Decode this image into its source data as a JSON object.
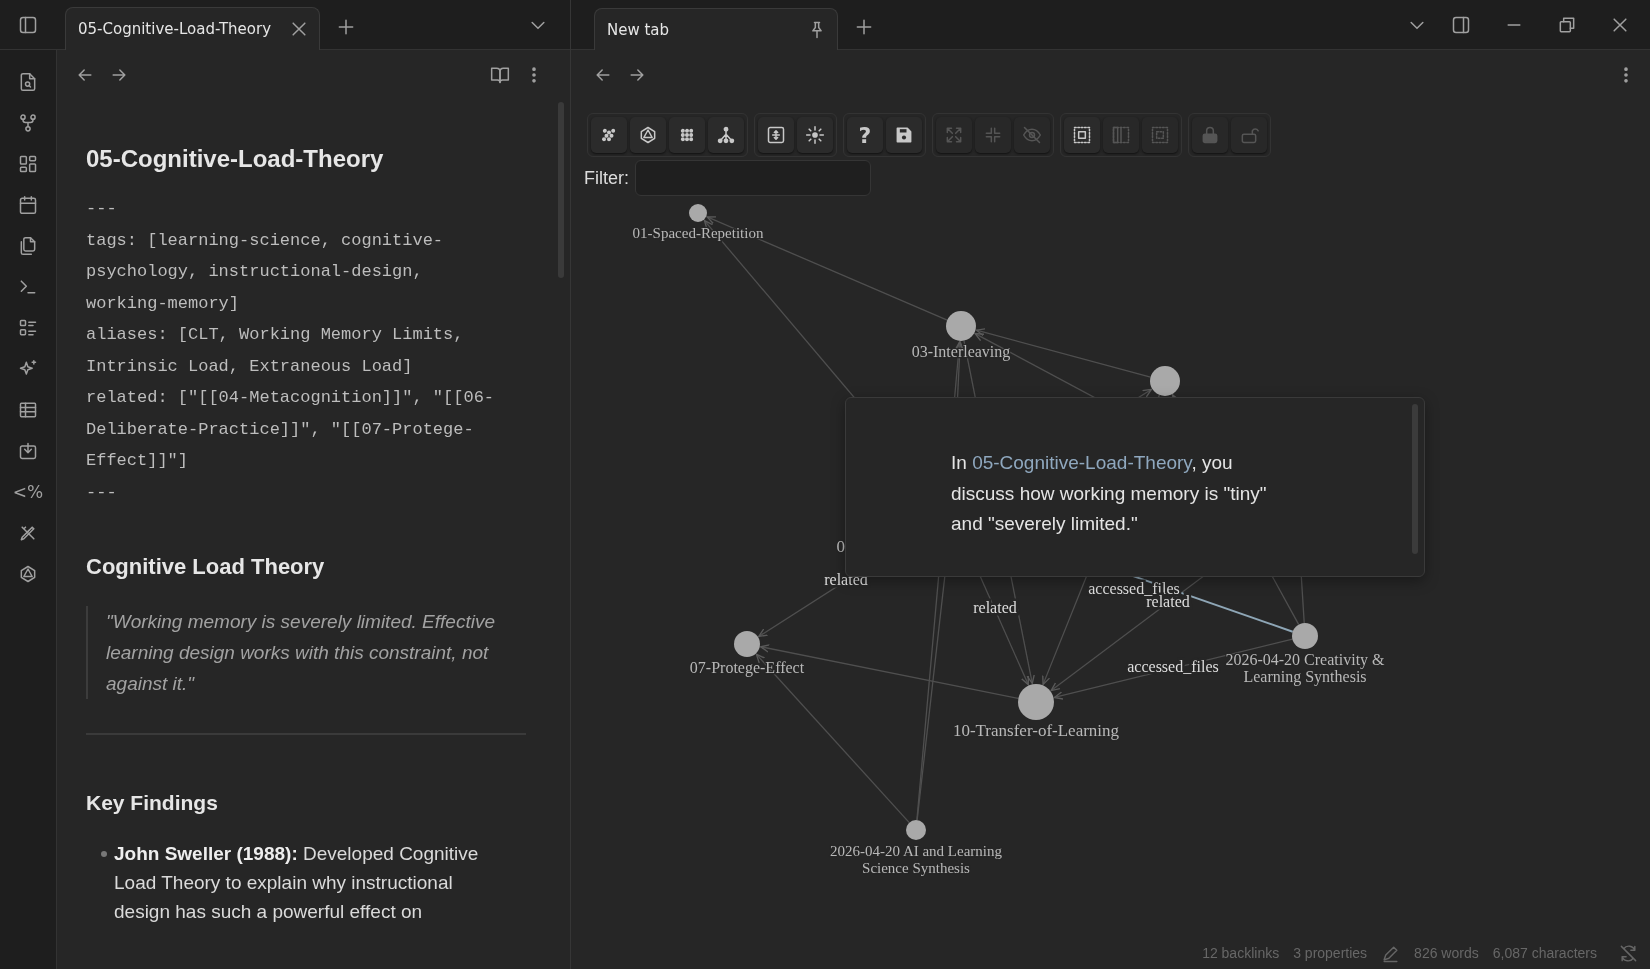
{
  "left_pane": {
    "tabs": [
      {
        "title": "05-Cognitive-Load-Theory",
        "selected": true
      }
    ],
    "ribbon": [
      {
        "kind": "icon"
      },
      {
        "kind": "icon"
      },
      {
        "kind": "icon"
      },
      {
        "kind": "icon"
      },
      {
        "kind": "icon"
      },
      {
        "kind": "icon"
      },
      {
        "kind": "icon"
      },
      {
        "kind": "icon"
      },
      {
        "kind": "icon"
      },
      {
        "kind": "icon"
      },
      {
        "kind": "text",
        "label": "<%"
      },
      {
        "kind": "icon"
      },
      {
        "kind": "icon"
      }
    ],
    "note": {
      "title": "05-Cognitive-Load-Theory",
      "frontmatter": [
        "---",
        "tags: [learning-science, cognitive-psychology, instructional-design, working-memory]",
        "aliases: [CLT, Working Memory Limits, Intrinsic Load, Extraneous Load]",
        "related: [\"[[04-Metacognition]]\", \"[[06-Deliberate-Practice]]\", \"[[07-Protege-Effect]]\"]",
        "---"
      ],
      "heading": "Cognitive Load Theory",
      "quote": "\"Working memory is severely limited. Effective learning design works with this constraint, not against it.\"",
      "section": "Key Findings",
      "bullets": [
        "**John Sweller (1988):** Developed Cognitive Load Theory to explain why instructional design has such a powerful effect on"
      ]
    }
  },
  "right_pane": {
    "tabs": [
      {
        "title": "New tab",
        "selected": true
      }
    ],
    "graph": {
      "toolbar": [
        {
          "buttons": [
            {
              "disabled": false
            },
            {
              "disabled": false
            },
            {
              "disabled": false
            },
            {
              "disabled": false
            }
          ]
        },
        {
          "buttons": [
            {
              "disabled": false
            },
            {
              "disabled": false
            }
          ]
        },
        {
          "buttons": [
            {
              "disabled": false,
              "label": "?"
            },
            {
              "disabled": false
            }
          ]
        },
        {
          "buttons": [
            {
              "disabled": true
            },
            {
              "disabled": true
            },
            {
              "disabled": true
            }
          ]
        },
        {
          "buttons": [
            {
              "disabled": false
            },
            {
              "disabled": true
            },
            {
              "disabled": true
            }
          ]
        },
        {
          "buttons": [
            {
              "disabled": true
            },
            {
              "disabled": true
            }
          ]
        }
      ],
      "filter": {
        "label": "Filter:"
      },
      "node_labels": [
        {
          "lines": [
            "01-Spaced-Repetition"
          ]
        },
        {
          "lines": [
            "03-Interleaving"
          ]
        },
        {
          "lines": [
            "0"
          ]
        },
        {
          "lines": [
            "07-Protege-Effect"
          ]
        },
        {
          "lines": [
            "10-Transfer-of-Learning"
          ]
        },
        {
          "lines": [
            "2026-04-20 Creativity &",
            "Learning Synthesis"
          ]
        },
        {
          "lines": [
            "2026-04-20 AI and Learning",
            "Science Synthesis"
          ]
        }
      ],
      "edges": [
        {
          "highlighted": false
        },
        {
          "highlighted": false
        },
        {
          "highlighted": false
        },
        {
          "highlighted": false
        },
        {
          "highlighted": false
        },
        {
          "highlighted": false
        },
        {
          "highlighted": false
        },
        {
          "highlighted": false
        },
        {
          "highlighted": false
        },
        {
          "highlighted": false
        },
        {
          "label": "related",
          "highlighted": false
        },
        {
          "label": "related",
          "highlighted": false
        },
        {
          "label": "accessed_files",
          "highlighted": true
        },
        {
          "label": "related",
          "highlighted": false
        },
        {
          "label": "accessed_files",
          "highlighted": false
        },
        {
          "highlighted": false
        },
        {
          "highlighted": false
        },
        {
          "highlighted": false
        },
        {
          "highlighted": false
        }
      ],
      "popover": {
        "before": "In ",
        "link": "05-Cognitive-Load-Theory",
        "after": ", you discuss how working memory is \"tiny\" and \"severely limited.\""
      }
    },
    "status_bar": {
      "backlinks": "12 backlinks",
      "properties": "3 properties",
      "words": "826 words",
      "characters": "6,087 characters",
      "sync_enabled": false
    }
  }
}
